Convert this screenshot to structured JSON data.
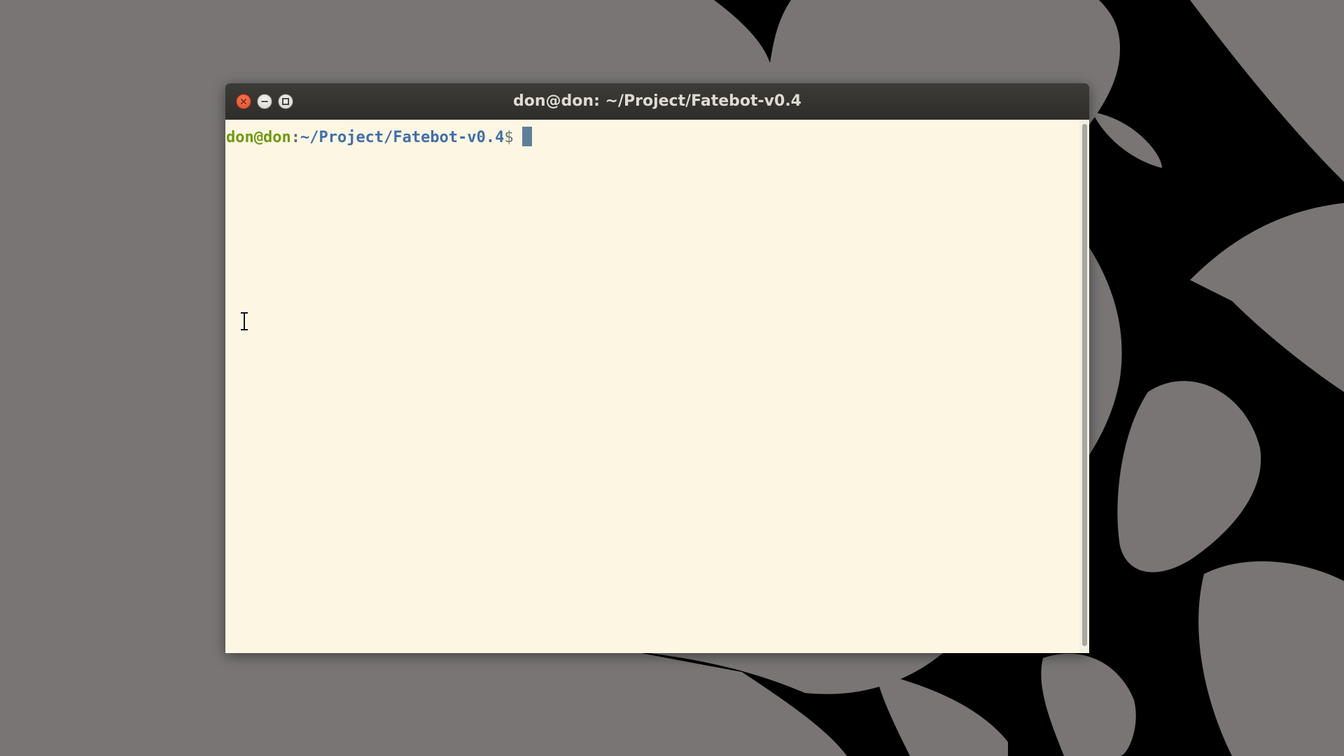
{
  "desktop": {
    "wallpaper_colors": {
      "background": "#787574",
      "shape": "#000000"
    }
  },
  "window": {
    "title": "don@don: ~/Project/Fatebot-v0.4",
    "buttons": {
      "close": "close-icon",
      "minimize": "minimize-icon",
      "maximize": "maximize-icon"
    }
  },
  "terminal": {
    "prompt": {
      "user_host": "don@don",
      "separator": ":",
      "path": "~/Project/Fatebot-v0.4",
      "symbol": "$"
    },
    "colors": {
      "background": "#fdf6e3",
      "user_host": "#6f9a12",
      "path": "#3f6fa8",
      "cursor": "#5f7f99"
    }
  }
}
